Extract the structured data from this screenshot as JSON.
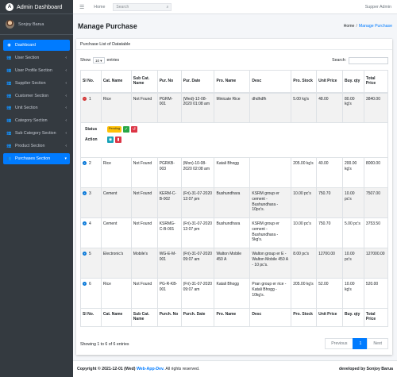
{
  "brand": {
    "title": "Admin Dashboard"
  },
  "user": {
    "name": "Sonjoy Barua"
  },
  "sidebar": {
    "items": [
      {
        "label": "Dashboard",
        "icon": "dashboard-icon"
      },
      {
        "label": "User Section",
        "icon": "users-icon"
      },
      {
        "label": "User Profile Section",
        "icon": "users-icon"
      },
      {
        "label": "Supplier Section",
        "icon": "users-icon"
      },
      {
        "label": "Customer Section",
        "icon": "users-icon"
      },
      {
        "label": "Unit Section",
        "icon": "users-icon"
      },
      {
        "label": "Category Section",
        "icon": "users-icon"
      },
      {
        "label": "Sub Category Section",
        "icon": "users-icon"
      },
      {
        "label": "Product Section",
        "icon": "users-icon"
      },
      {
        "label": "Purchases Section",
        "icon": "users-icon"
      }
    ]
  },
  "topbar": {
    "home": "Home",
    "search_placeholder": "Search",
    "admin": "Supper Admin"
  },
  "page": {
    "title": "Manage Purchase"
  },
  "breadcrumb": {
    "home": "Home",
    "sep": "/",
    "current": "Manage Purchase"
  },
  "card": {
    "header": "Purchase List of Datatable"
  },
  "controls": {
    "show": "Show",
    "length": "10",
    "entries": "entries",
    "search": "Search:"
  },
  "table": {
    "headers": [
      "Sl No.",
      "Cat. Name",
      "Sub Cat. Name",
      "Pur. No",
      "Pur. Date",
      "Pro. Name",
      "Desc",
      "Pro. Stock",
      "Unit Price",
      "Buy. qty",
      "Total Price"
    ],
    "footers": [
      "Sl No.",
      "Cat. Name",
      "Sub Cat. Name",
      "Purch. No",
      "Purch. Date",
      "Pro. Name",
      "Desc",
      "Pro. Stock",
      "Unit Price",
      "Buy. qty",
      "Total Price"
    ],
    "rows": [
      [
        "1",
        "Rice",
        "Not Found",
        "PGRM-001",
        "(Wed)-12-08-2020 01:08 am",
        "Minicate Rice",
        "dhdhdfh",
        "5.00 kg's",
        "48.00",
        "80.00 kg's",
        "3840.00"
      ],
      [
        "2",
        "Rice",
        "Not Found",
        "PGRKB-003",
        "(Mon)-10-08-2020 02:08 am",
        "Katali Bhogg",
        "",
        "205.00 kg's",
        "40.00",
        "200.00 kg's",
        "8000.00"
      ],
      [
        "3",
        "Cement",
        "Not Found",
        "KERM-C-B-002",
        "(Fri)-31-07-2020 12:07 pm",
        "Bushundhara",
        "KSRM group er cement - Bushundhara - 10pc's.",
        "10.00 pc's",
        "750.70",
        "10.00 pc's",
        "7507.00"
      ],
      [
        "4",
        "Cement",
        "Not Found",
        "KSRMG-C-B-001",
        "(Fri)-31-07-2020 12:07 pm",
        "Bushundhara",
        "KSRM group er cement - Bushundhara - 5kg's.",
        "10.00 pc's",
        "750.70",
        "5.00 pc's",
        "3753.50"
      ],
      [
        "5",
        "Electronic's",
        "Mobile's",
        "WG-E-M-001",
        "(Fri)-31-07-2020 09:07 am",
        "Walton Mobile 450 A",
        "Walton group er E - Walton Mobile 450 A - 10 pc's.",
        "8.00 pc's",
        "12700.00",
        "10.00 pc's",
        "127000.00"
      ],
      [
        "6",
        "Rice",
        "Not Found",
        "PG-R-KB-001",
        "(Fri)-31-07-2020 09:07 am",
        "Katali Bhogg",
        "Pran group er rice - Katali Bhogg - 10kg's.",
        "205.00 kg's",
        "52.00",
        "10.00 kg's",
        "520.00"
      ]
    ],
    "child": {
      "status_label": "Status",
      "status_badge": "Pending",
      "action_label": "Action"
    }
  },
  "info": "Showing 1 to 6 of 6 entries",
  "pager": {
    "prev": "Previous",
    "page": "1",
    "next": "Next"
  },
  "footer": {
    "prefix": "Copyright © 2021-12-01 (Wed)",
    "link": "Web-App-Dev.",
    "suffix": "All rights reserved.",
    "right": "developed by Sonjoy Barua"
  },
  "colors": {
    "sidebar": "#343a40",
    "accent": "#007bff",
    "pending": "#ffc107"
  }
}
